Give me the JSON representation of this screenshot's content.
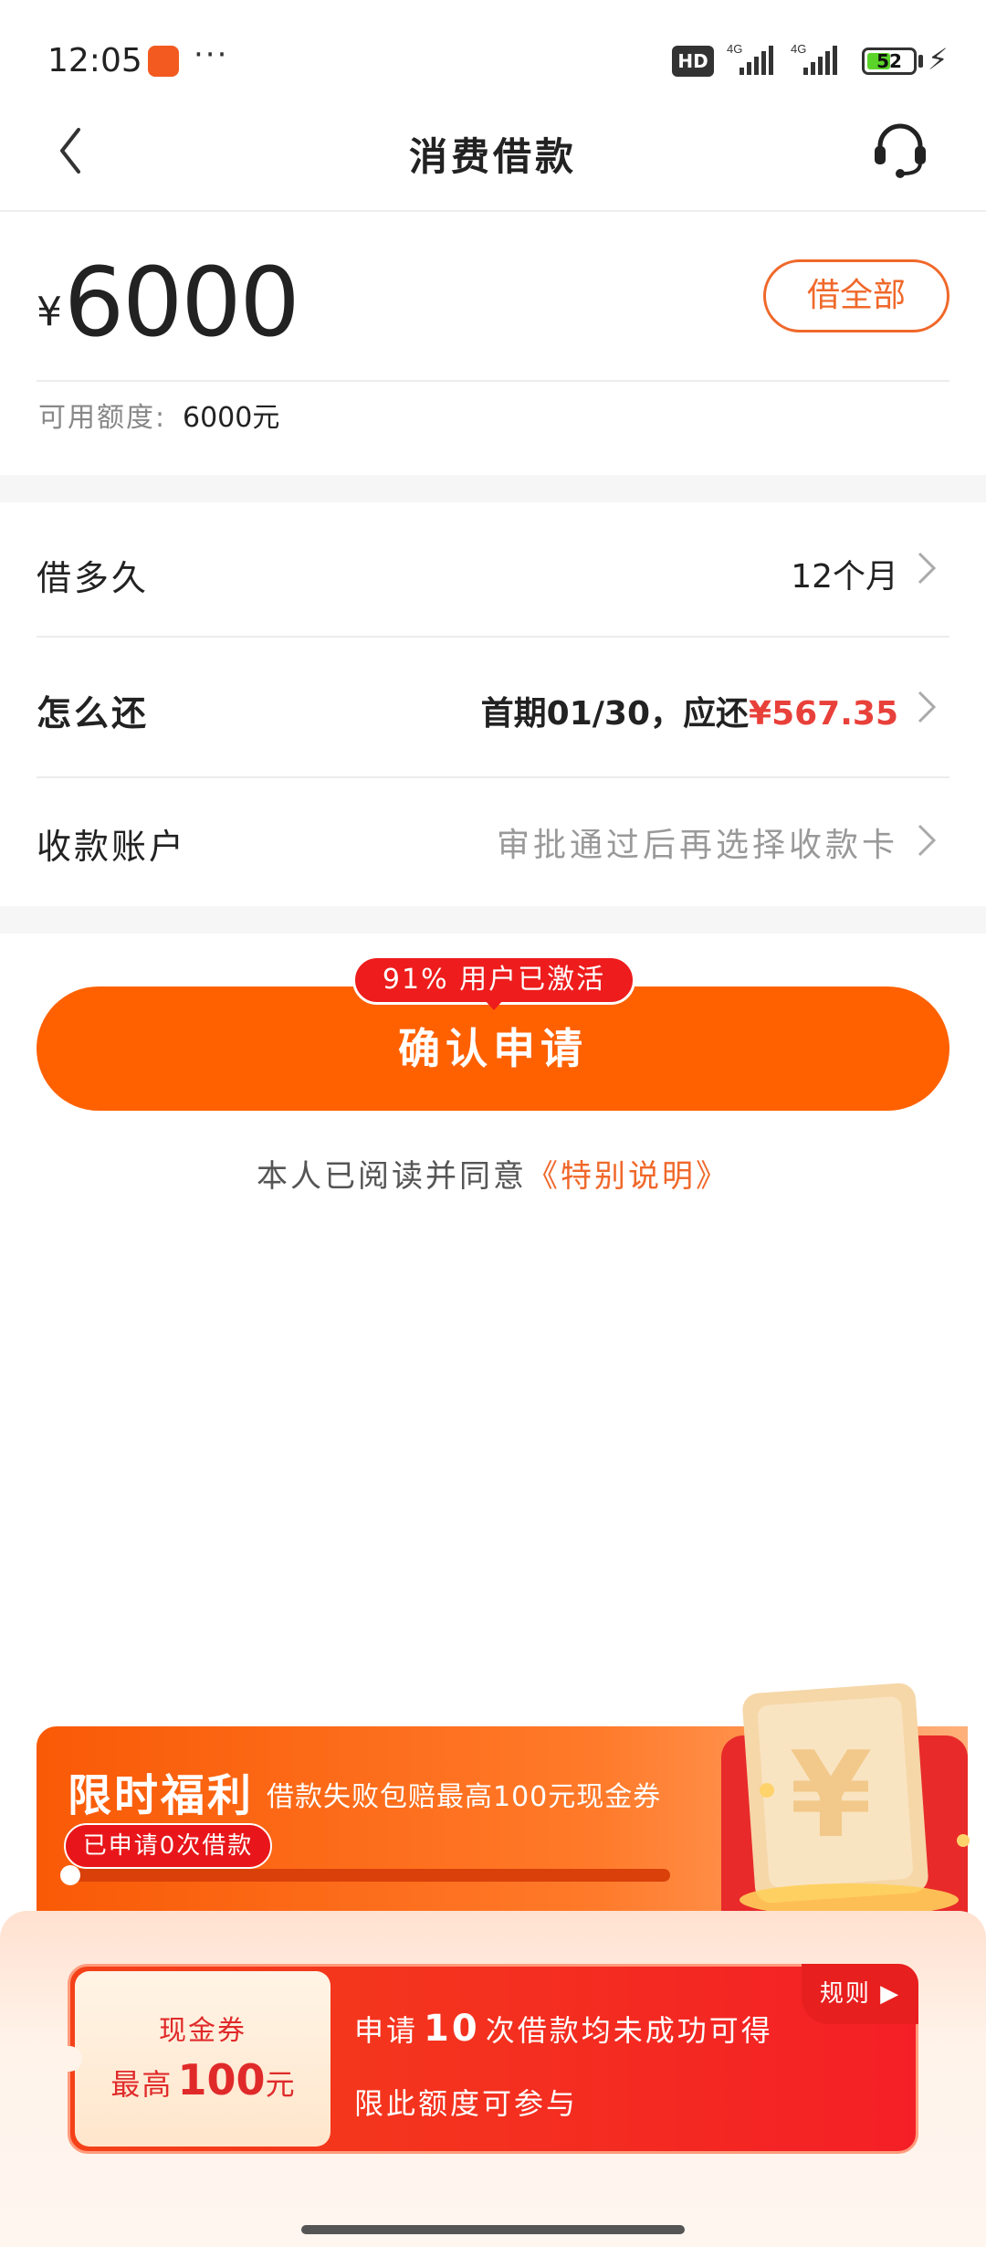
{
  "status_bar": {
    "time": "12:05",
    "dots": "···",
    "hd_label": "HD",
    "signal_label": "4G",
    "battery": "52",
    "battery_level": 0.52,
    "app_icon": "app-badge-icon"
  },
  "nav": {
    "title": "消费借款",
    "back_icon": "chevron-left-icon",
    "service_icon": "headset-icon"
  },
  "amount": {
    "currency": "¥",
    "value": "6000",
    "borrow_all_label": "借全部",
    "quota_label": "可用额度:",
    "quota_value": "6000元"
  },
  "options": {
    "term": {
      "label": "借多久",
      "value": "12个月"
    },
    "repay": {
      "label": "怎么还",
      "value_prefix": "首期01/30，应还",
      "value_amount": "¥567.35"
    },
    "account": {
      "label": "收款账户",
      "value": "审批通过后再选择收款卡"
    }
  },
  "confirm": {
    "badge": "91% 用户已激活",
    "button_label": "确认申请",
    "agree_text": "本人已阅读并同意",
    "agree_link": "《特别说明》"
  },
  "promo": {
    "title": "限时福利",
    "subtitle": "借款失败包赔最高100元现金券",
    "applied": "已申请0次借款",
    "progress": 0,
    "coupon_label": "现金券",
    "coupon_max_prefix": "最高",
    "coupon_max_value": "100",
    "coupon_max_unit": "元",
    "line1_prefix": "申请",
    "line1_count": "10",
    "line1_suffix": "次借款均未成功可得",
    "line2": "限此额度可参与",
    "rules": "规则 ▶"
  },
  "colors": {
    "accent": "#ff6100",
    "link": "#f0682a",
    "red": "#ee1c1c",
    "amount_red": "#e8403a"
  }
}
